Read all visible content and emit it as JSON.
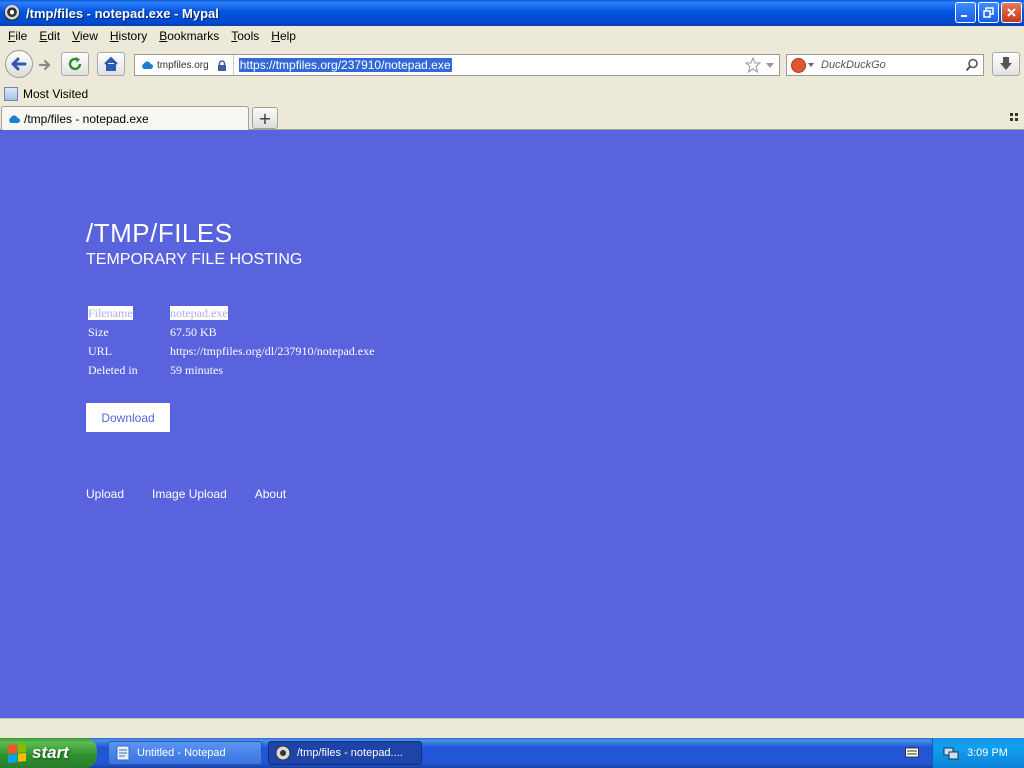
{
  "window": {
    "title": "/tmp/files - notepad.exe - Mypal"
  },
  "menu": [
    "File",
    "Edit",
    "View",
    "History",
    "Bookmarks",
    "Tools",
    "Help"
  ],
  "menu_accel": [
    "F",
    "E",
    "V",
    "H",
    "B",
    "T",
    "H"
  ],
  "navbar": {
    "identity_host": "tmpfiles.org",
    "url": "https://tmpfiles.org/237910/notepad.exe",
    "search_placeholder": "DuckDuckGo"
  },
  "bookmarks": {
    "most_visited": "Most Visited"
  },
  "tabs": {
    "active_label": "/tmp/files - notepad.exe",
    "new_tab": "+"
  },
  "page": {
    "title": "/TMP/FILES",
    "subtitle": "TEMPORARY FILE HOSTING",
    "info": [
      {
        "key": "Filename",
        "value": "notepad.exe"
      },
      {
        "key": "Size",
        "value": "67.50 KB"
      },
      {
        "key": "URL",
        "value": "https://tmpfiles.org/dl/237910/notepad.exe"
      },
      {
        "key": "Deleted in",
        "value": "59 minutes"
      }
    ],
    "download_label": "Download",
    "footer": [
      "Upload",
      "Image Upload",
      "About"
    ]
  },
  "colors": {
    "page_background": "#5a63de",
    "selection": "#3369d6"
  },
  "taskbar": {
    "start_label": "start",
    "tasks": [
      {
        "label": "Untitled - Notepad",
        "active": false
      },
      {
        "label": "/tmp/files - notepad....",
        "active": true
      }
    ],
    "clock": "3:09 PM"
  }
}
